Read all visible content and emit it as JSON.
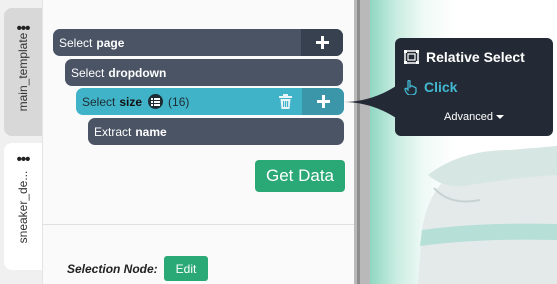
{
  "tabs": [
    {
      "label": "main_template",
      "menu_icon": "more-dots-icon"
    },
    {
      "label": "sneaker_de...",
      "menu_icon": "more-dots-icon"
    }
  ],
  "commands": [
    {
      "verb": "Select",
      "target": "page"
    },
    {
      "verb": "Select",
      "target": "dropdown"
    },
    {
      "verb": "Select",
      "target": "size",
      "count": "(16)",
      "icons": [
        "list-icon",
        "trash-icon",
        "plus-icon"
      ]
    },
    {
      "verb": "Extract",
      "target": "name"
    }
  ],
  "get_data_label": "Get Data",
  "selection_node": {
    "label": "Selection Node:",
    "edit_label": "Edit"
  },
  "popup": {
    "relative_select": "Relative Select",
    "click": "Click",
    "advanced": "Advanced"
  },
  "colors": {
    "command_bg": "#4a5465",
    "selected_command_bg": "#41b3c8",
    "button_green": "#2aa977",
    "popup_bg": "#242a35",
    "click_accent": "#42b8d2"
  }
}
